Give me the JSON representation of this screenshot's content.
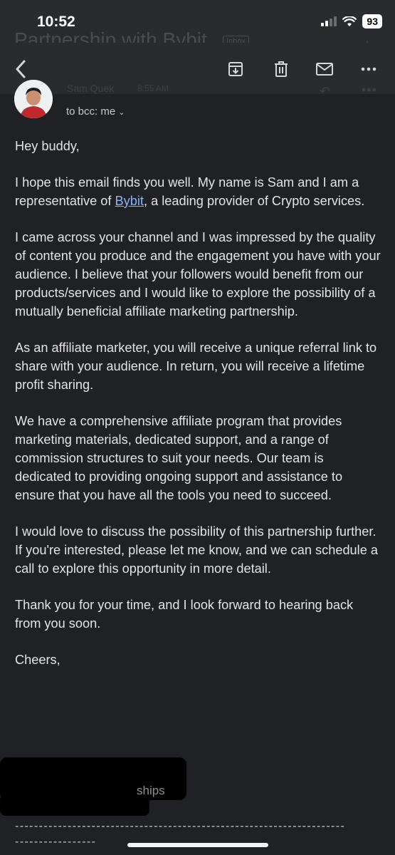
{
  "status": {
    "time": "10:52",
    "battery": "93"
  },
  "email": {
    "subject": "Partnership with Bybit",
    "label": "Inbox",
    "sender": "Sam Quek",
    "sent_time": "8:55 AM",
    "recipient_line": "to bcc: me",
    "greeting": "Hey buddy,",
    "p1_before": "I hope this email finds you well. My name is Sam and I am a representative of ",
    "p1_link": "Bybit",
    "p1_after": ", a leading provider of Crypto services.",
    "p2": "I came across your channel and I was impressed by the quality of content you produce and the engagement you have with your audience. I believe that your followers would benefit from our products/services and I would like to explore the possibility of a mutually beneficial affiliate marketing partnership.",
    "p3": "As an affiliate marketer, you will receive a unique referral link to share with your audience. In return, you will receive a lifetime profit sharing.",
    "p4": "We have a comprehensive affiliate program that provides marketing materials, dedicated support, and a range of commission structures to suit your needs. Our team is dedicated to providing ongoing support and assistance to ensure that you have all the tools you need to succeed.",
    "p5": "I would love to discuss the possibility of this partnership further. If you're interested, please let me know, and we can schedule a call to explore this opportunity in more detail.",
    "p6": "Thank you for your time, and I look forward to hearing back from you soon.",
    "closing": "Cheers,",
    "signature_fragment": "ships",
    "divider_1": "---------------------------------------------------------------------",
    "divider_2": "-----------------"
  },
  "icons": {
    "back": "back-arrow-icon",
    "archive": "archive-icon",
    "delete": "trash-icon",
    "mark_unread": "mail-icon",
    "more": "more-horizontal-icon"
  }
}
